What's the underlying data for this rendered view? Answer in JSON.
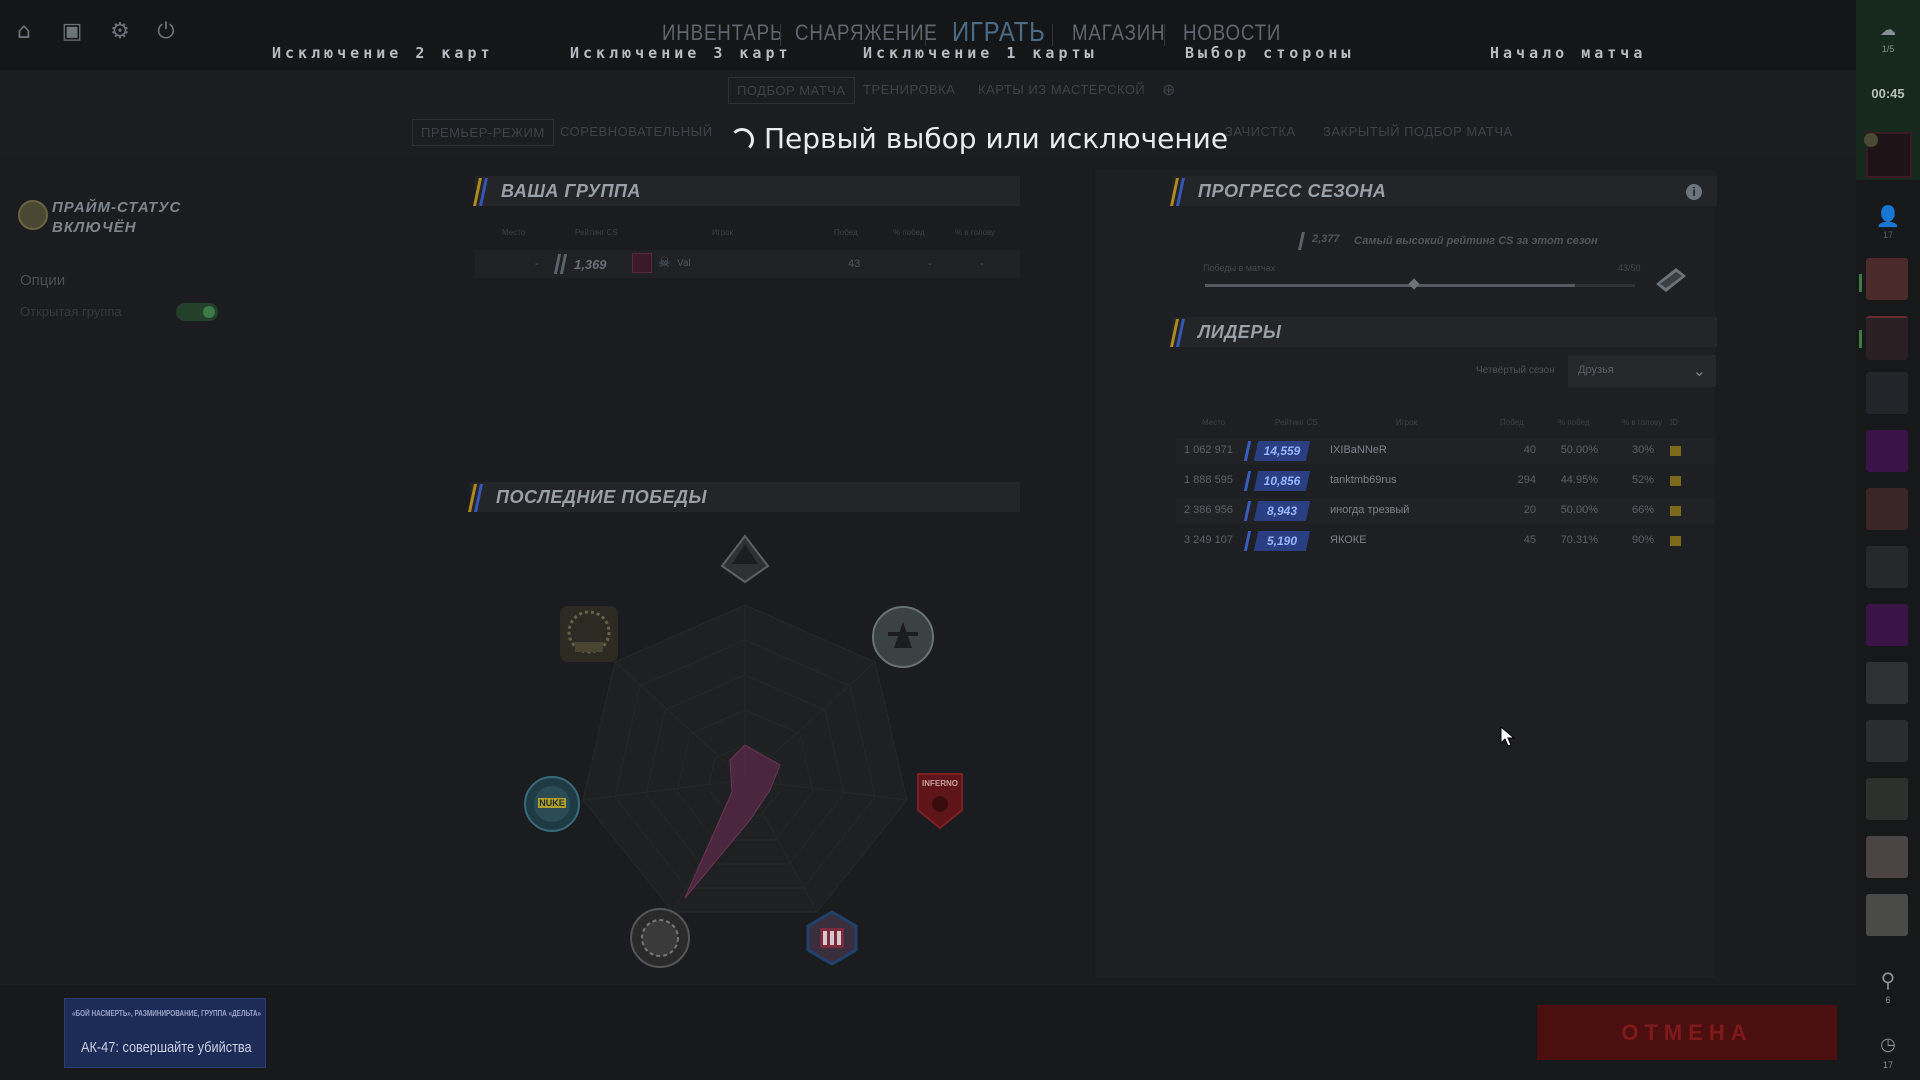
{
  "topbar": {
    "icons": [
      "home-icon",
      "tv-icon",
      "gear-icon",
      "power-icon"
    ],
    "nav": [
      "ИНВЕНТАРЬ",
      "СНАРЯЖЕНИЕ",
      "ИГРАТЬ",
      "МАГАЗИН",
      "НОВОСТИ"
    ],
    "active_nav": "ИГРАТЬ",
    "stages": [
      "Исключение 2 карт",
      "Исключение 3 карт",
      "Исключение 1 карты",
      "Выбор стороны",
      "Начало матча"
    ]
  },
  "subnav": {
    "row1": [
      "ПОДБОР МАТЧА",
      "ТРЕНИРОВКА",
      "КАРТЫ ИЗ МАСТЕРСКОЙ"
    ],
    "row2": [
      "ПРЕМЬЕР-РЕЖИМ",
      "СОРЕВНОВАТЕЛЬНЫЙ",
      "ЗАЧИСТКА",
      "ЗАКРЫТЫЙ ПОДБОР МАТЧА"
    ]
  },
  "banner": "Первый выбор или исключение",
  "left": {
    "prime_status": "ПРАЙМ-СТАТУС ВКЛЮЧЁН",
    "options_label": "Опции",
    "open_group_label": "Открытая группа",
    "open_group_on": true
  },
  "group": {
    "title": "ВАША ГРУППА",
    "columns": [
      "Место",
      "Рейтинг CS",
      "Игрок",
      "Побед",
      "% побед",
      "% в голову"
    ],
    "rows": [
      {
        "place": "-",
        "rating": "1,369",
        "player": "Val",
        "wins": "43",
        "win_pct": "-",
        "hs_pct": "-"
      }
    ]
  },
  "recent_wins": {
    "title": "ПОСЛЕДНИЕ ПОБЕДЫ",
    "maps": [
      "Vertigo",
      "Highway",
      "Inferno",
      "Office",
      "Dust",
      "Nuke",
      "Ancient"
    ],
    "icons": [
      "vertigo-icon",
      "highway-icon",
      "inferno-icon",
      "office-icon",
      "dust-icon",
      "nuke-icon",
      "ancient-icon"
    ],
    "map_labels": {
      "inferno": "INFERNO",
      "nuke": "NUKE"
    }
  },
  "season": {
    "title": "ПРОГРЕСС СЕЗОНА",
    "best_rating": "2,377",
    "best_rating_label": "Самый высокий рейтинг CS за этот сезон",
    "wins_label": "Победы в матчах",
    "wins_count": "43/50",
    "progress": 0.86
  },
  "leaders": {
    "title": "ЛИДЕРЫ",
    "season_label": "Четвёртый сезон",
    "filter_value": "Друзья",
    "columns": [
      "Место",
      "Рейтинг CS",
      "Игрок",
      "Побед",
      "% побед",
      "% в голову",
      "ID"
    ],
    "rows": [
      {
        "place": "1 062 971",
        "rating": "14,559",
        "player": "IXIBaNNeR",
        "wins": "40",
        "win_pct": "50.00%",
        "hs_pct": "30%"
      },
      {
        "place": "1 888 595",
        "rating": "10,856",
        "player": "tanktmb69rus",
        "wins": "294",
        "win_pct": "44.95%",
        "hs_pct": "52%"
      },
      {
        "place": "2 386 956",
        "rating": "8,943",
        "player": "иногда трезвый",
        "wins": "20",
        "win_pct": "50.00%",
        "hs_pct": "66%"
      },
      {
        "place": "3 249 107",
        "rating": "5,190",
        "player": "ЯКОКЕ",
        "wins": "45",
        "win_pct": "70.31%",
        "hs_pct": "90%"
      }
    ]
  },
  "sidebar": {
    "party_count": "1/5",
    "timer": "00:45",
    "friends_count": "17",
    "signal_count": "6",
    "history_count": "17"
  },
  "mission": {
    "title": "«БОЙ НАСМЕРТЬ», РАЗМИНИРОВАНИЕ, ГРУППА «ДЕЛЬТА»",
    "task": "АК-47: совершайте убийства"
  },
  "cancel_label": "ОТМЕНА",
  "colors": {
    "rank_blue": "#2a3f82",
    "cancel_red": "#4c0f10",
    "accent_yellow": "#b08a1a",
    "accent_blue": "#3656b8"
  }
}
